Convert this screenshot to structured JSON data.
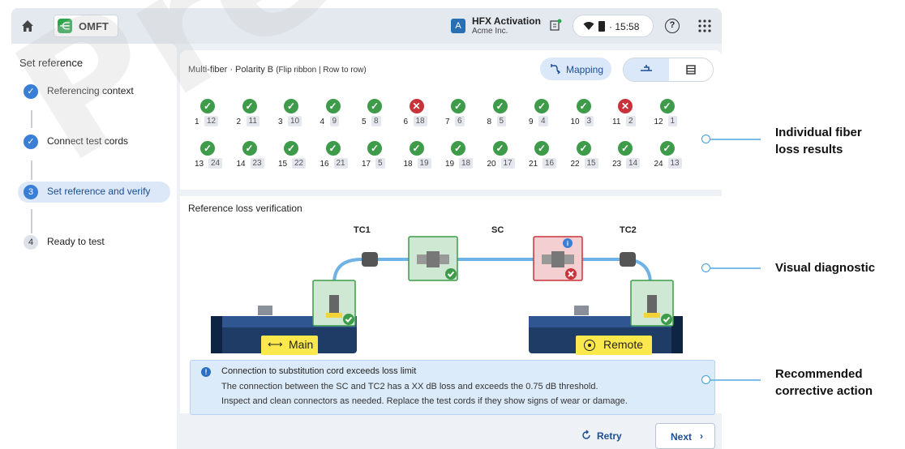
{
  "topbar": {
    "app_name": "OMFT",
    "account_badge": "A",
    "account_name": "HFX Activation",
    "account_org": "Acme Inc.",
    "time": "15:58",
    "help_glyph": "?"
  },
  "sidebar": {
    "title": "Set reference",
    "steps": [
      {
        "num": "✓",
        "label": "Referencing context",
        "state": "done"
      },
      {
        "num": "✓",
        "label": "Connect test cords",
        "state": "done"
      },
      {
        "num": "3",
        "label": "Set reference and verify",
        "state": "active"
      },
      {
        "num": "4",
        "label": "Ready to test",
        "state": "todo"
      }
    ]
  },
  "main": {
    "mf_title_main": "Multi-fiber · Polarity B",
    "mf_title_sub": "(Flip ribbon | Row to row)",
    "mapping_label": "Mapping",
    "fibers": [
      {
        "n": "1",
        "m": "12",
        "status": "pass"
      },
      {
        "n": "2",
        "m": "11",
        "status": "pass"
      },
      {
        "n": "3",
        "m": "10",
        "status": "pass"
      },
      {
        "n": "4",
        "m": "9",
        "status": "pass"
      },
      {
        "n": "5",
        "m": "8",
        "status": "pass"
      },
      {
        "n": "6",
        "m": "18",
        "status": "fail"
      },
      {
        "n": "7",
        "m": "6",
        "status": "pass"
      },
      {
        "n": "8",
        "m": "5",
        "status": "pass"
      },
      {
        "n": "9",
        "m": "4",
        "status": "pass"
      },
      {
        "n": "10",
        "m": "3",
        "status": "pass"
      },
      {
        "n": "11",
        "m": "2",
        "status": "fail"
      },
      {
        "n": "12",
        "m": "1",
        "status": "pass"
      },
      {
        "n": "13",
        "m": "24",
        "status": "pass"
      },
      {
        "n": "14",
        "m": "23",
        "status": "pass"
      },
      {
        "n": "15",
        "m": "22",
        "status": "pass"
      },
      {
        "n": "16",
        "m": "21",
        "status": "pass"
      },
      {
        "n": "17",
        "m": "5",
        "status": "pass"
      },
      {
        "n": "18",
        "m": "19",
        "status": "pass"
      },
      {
        "n": "19",
        "m": "18",
        "status": "pass"
      },
      {
        "n": "20",
        "m": "17",
        "status": "pass"
      },
      {
        "n": "21",
        "m": "16",
        "status": "pass"
      },
      {
        "n": "22",
        "m": "15",
        "status": "pass"
      },
      {
        "n": "23",
        "m": "14",
        "status": "pass"
      },
      {
        "n": "24",
        "m": "13",
        "status": "pass"
      }
    ],
    "verify_title": "Reference loss verification",
    "diagram": {
      "tc1": "TC1",
      "sc": "SC",
      "tc2": "TC2",
      "main_label": "Main",
      "remote_label": "Remote"
    },
    "alert": {
      "title": "Connection to substitution cord exceeds loss limit",
      "line1": "The connection between the SC and TC2 has a XX dB loss and exceeds the 0.75 dB threshold.",
      "line2": "Inspect and clean connectors as needed. Replace the test cords if they show signs of wear or damage."
    },
    "retry_label": "Retry",
    "next_label": "Next"
  },
  "callouts": {
    "c1_line1": "Individual fiber",
    "c1_line2": "loss results",
    "c2_line1": "Visual diagnostic",
    "c3_line1": "Recommended",
    "c3_line2": "corrective action"
  },
  "watermark": "Prelimin",
  "colors": {
    "pass": "#3d9b4a",
    "fail": "#c8333a",
    "accent": "#3a7fd5",
    "highlight": "#fbe84c"
  }
}
